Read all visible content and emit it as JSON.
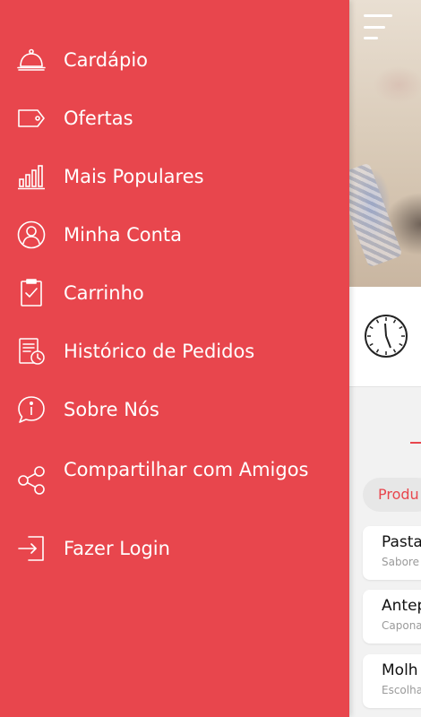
{
  "drawer": {
    "items": [
      {
        "label": "Cardápio",
        "icon": "cloche-icon"
      },
      {
        "label": "Ofertas",
        "icon": "tag-icon"
      },
      {
        "label": "Mais Populares",
        "icon": "bar-chart-icon"
      },
      {
        "label": "Minha Conta",
        "icon": "user-icon"
      },
      {
        "label": "Carrinho",
        "icon": "clipboard-check-icon"
      },
      {
        "label": "Histórico de Pedidos",
        "icon": "order-history-icon"
      },
      {
        "label": "Sobre Nós",
        "icon": "info-chat-icon"
      },
      {
        "label": "Compartilhar com Amigos",
        "icon": "share-icon"
      },
      {
        "label": "Fazer Login",
        "icon": "login-icon"
      }
    ]
  },
  "background": {
    "filter_label": "Produ",
    "products": [
      {
        "name": "Pasta",
        "desc": "Sabore"
      },
      {
        "name": "Antep",
        "desc": "Capona"
      },
      {
        "name": "Molh",
        "desc": "Escolha"
      }
    ]
  },
  "colors": {
    "drawer_bg": "#e8464d",
    "accent": "#e8464d",
    "text_on_drawer": "#ffffff"
  }
}
